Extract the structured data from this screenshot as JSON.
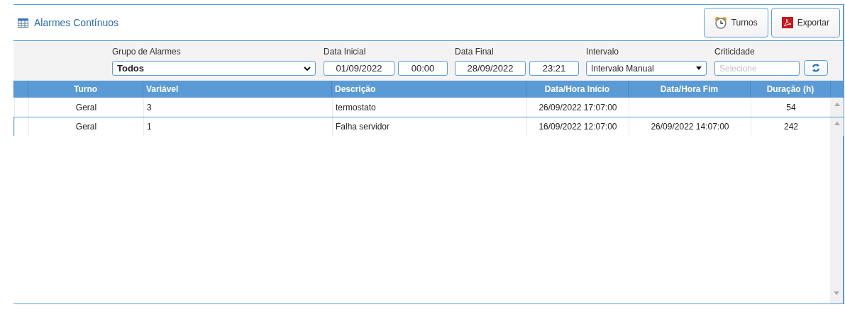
{
  "title": "Alarmes Contínuos",
  "buttons": [
    {
      "kind": "clock",
      "label": "Turnos"
    },
    {
      "kind": "pdf",
      "label": "Exportar"
    }
  ],
  "filters": {
    "group": {
      "label": "Grupo de Alarmes",
      "value": "Todos"
    },
    "start": {
      "label": "Data Inicial",
      "date": "01/09/2022",
      "time": "00:00"
    },
    "end": {
      "label": "Data Final",
      "date": "28/09/2022",
      "time": "23:21"
    },
    "interval": {
      "label": "Intervalo",
      "value": "Intervalo Manual"
    },
    "criticality": {
      "label": "Criticidade",
      "placeholder": "Selecione"
    }
  },
  "table": {
    "columns": [
      "Turno",
      "Variável",
      "Descrição",
      "Data/Hora Início",
      "Data/Hora Fim",
      "Duração (h)"
    ],
    "rows": [
      {
        "selected": false,
        "cells": [
          "Geral",
          "3",
          "termostato",
          "26/09/2022 17:07:00",
          "",
          "54"
        ]
      },
      {
        "selected": true,
        "cells": [
          "Geral",
          "1",
          "Falha servidor",
          "16/09/2022 12:07:00",
          "26/09/2022 14:07:00",
          "242"
        ]
      }
    ]
  }
}
